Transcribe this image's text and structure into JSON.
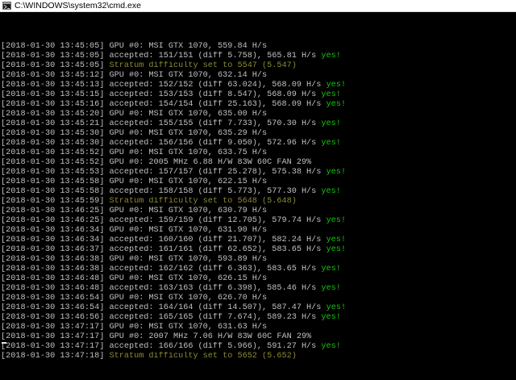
{
  "window": {
    "title": "C:\\WINDOWS\\system32\\cmd.exe",
    "icon": "cmd-console-icon"
  },
  "colors": {
    "background": "#000000",
    "text": "#c0c0c0",
    "accepted_ok": "#16c60c",
    "stratum_notice": "#8b8b33"
  },
  "console": {
    "lines": [
      {
        "ts": "[2018-01-30 13:45:05]",
        "msg": "GPU #0: MSI GTX 1070, 559.84 H/s",
        "type": "gpu",
        "yes": ""
      },
      {
        "ts": "[2018-01-30 13:45:05]",
        "msg": "accepted: 151/151 (diff 5.758), 565.81 H/s",
        "type": "accepted",
        "yes": "yes!"
      },
      {
        "ts": "[2018-01-30 13:45:05]",
        "msg": "Stratum difficulty set to 5547 (5.547)",
        "type": "stratum",
        "yes": ""
      },
      {
        "ts": "[2018-01-30 13:45:12]",
        "msg": "GPU #0: MSI GTX 1070, 632.14 H/s",
        "type": "gpu",
        "yes": ""
      },
      {
        "ts": "[2018-01-30 13:45:13]",
        "msg": "accepted: 152/152 (diff 63.024), 568.09 H/s",
        "type": "accepted",
        "yes": "yes!"
      },
      {
        "ts": "[2018-01-30 13:45:15]",
        "msg": "accepted: 153/153 (diff 8.547), 568.09 H/s",
        "type": "accepted",
        "yes": "yes!"
      },
      {
        "ts": "[2018-01-30 13:45:16]",
        "msg": "accepted: 154/154 (diff 25.163), 568.09 H/s",
        "type": "accepted",
        "yes": "yes!"
      },
      {
        "ts": "[2018-01-30 13:45:20]",
        "msg": "GPU #0: MSI GTX 1070, 635.00 H/s",
        "type": "gpu",
        "yes": ""
      },
      {
        "ts": "[2018-01-30 13:45:21]",
        "msg": "accepted: 155/155 (diff 7.733), 570.30 H/s",
        "type": "accepted",
        "yes": "yes!"
      },
      {
        "ts": "[2018-01-30 13:45:30]",
        "msg": "GPU #0: MSI GTX 1070, 635.29 H/s",
        "type": "gpu",
        "yes": ""
      },
      {
        "ts": "[2018-01-30 13:45:30]",
        "msg": "accepted: 156/156 (diff 9.050), 572.96 H/s",
        "type": "accepted",
        "yes": "yes!"
      },
      {
        "ts": "[2018-01-30 13:45:52]",
        "msg": "GPU #0: MSI GTX 1070, 633.75 H/s",
        "type": "gpu",
        "yes": ""
      },
      {
        "ts": "[2018-01-30 13:45:52]",
        "msg": "GPU #0: 2005 MHz 6.88 H/W 83W 60C FAN 29%",
        "type": "gpu",
        "yes": ""
      },
      {
        "ts": "[2018-01-30 13:45:53]",
        "msg": "accepted: 157/157 (diff 25.278), 575.38 H/s",
        "type": "accepted",
        "yes": "yes!"
      },
      {
        "ts": "[2018-01-30 13:45:58]",
        "msg": "GPU #0: MSI GTX 1070, 622.15 H/s",
        "type": "gpu",
        "yes": ""
      },
      {
        "ts": "[2018-01-30 13:45:58]",
        "msg": "accepted: 158/158 (diff 5.773), 577.30 H/s",
        "type": "accepted",
        "yes": "yes!"
      },
      {
        "ts": "[2018-01-30 13:45:59]",
        "msg": "Stratum difficulty set to 5648 (5.648)",
        "type": "stratum",
        "yes": ""
      },
      {
        "ts": "[2018-01-30 13:46:25]",
        "msg": "GPU #0: MSI GTX 1070, 630.79 H/s",
        "type": "gpu",
        "yes": ""
      },
      {
        "ts": "[2018-01-30 13:46:25]",
        "msg": "accepted: 159/159 (diff 12.705), 579.74 H/s",
        "type": "accepted",
        "yes": "yes!"
      },
      {
        "ts": "[2018-01-30 13:46:34]",
        "msg": "GPU #0: MSI GTX 1070, 631.90 H/s",
        "type": "gpu",
        "yes": ""
      },
      {
        "ts": "[2018-01-30 13:46:34]",
        "msg": "accepted: 160/160 (diff 21.707), 582.24 H/s",
        "type": "accepted",
        "yes": "yes!"
      },
      {
        "ts": "[2018-01-30 13:46:37]",
        "msg": "accepted: 161/161 (diff 62.652), 583.65 H/s",
        "type": "accepted",
        "yes": "yes!"
      },
      {
        "ts": "[2018-01-30 13:46:38]",
        "msg": "GPU #0: MSI GTX 1070, 593.89 H/s",
        "type": "gpu",
        "yes": ""
      },
      {
        "ts": "[2018-01-30 13:46:38]",
        "msg": "accepted: 162/162 (diff 6.363), 583.65 H/s",
        "type": "accepted",
        "yes": "yes!"
      },
      {
        "ts": "[2018-01-30 13:46:48]",
        "msg": "GPU #0: MSI GTX 1070, 626.15 H/s",
        "type": "gpu",
        "yes": ""
      },
      {
        "ts": "[2018-01-30 13:46:48]",
        "msg": "accepted: 163/163 (diff 6.398), 585.46 H/s",
        "type": "accepted",
        "yes": "yes!"
      },
      {
        "ts": "[2018-01-30 13:46:54]",
        "msg": "GPU #0: MSI GTX 1070, 626.70 H/s",
        "type": "gpu",
        "yes": ""
      },
      {
        "ts": "[2018-01-30 13:46:54]",
        "msg": "accepted: 164/164 (diff 14.507), 587.47 H/s",
        "type": "accepted",
        "yes": "yes!"
      },
      {
        "ts": "[2018-01-30 13:46:56]",
        "msg": "accepted: 165/165 (diff 7.674), 589.23 H/s",
        "type": "accepted",
        "yes": "yes!"
      },
      {
        "ts": "[2018-01-30 13:47:17]",
        "msg": "GPU #0: MSI GTX 1070, 631.63 H/s",
        "type": "gpu",
        "yes": ""
      },
      {
        "ts": "[2018-01-30 13:47:17]",
        "msg": "GPU #0: 2007 MHz 7.06 H/W 83W 60C FAN 29%",
        "type": "gpu",
        "yes": ""
      },
      {
        "ts": "[2018-01-30 13:47:17]",
        "msg": "accepted: 166/166 (diff 5.966), 591.27 H/s",
        "type": "accepted",
        "yes": "yes!"
      },
      {
        "ts": "[2018-01-30 13:47:18]",
        "msg": "Stratum difficulty set to 5652 (5.652)",
        "type": "stratum",
        "yes": ""
      }
    ]
  }
}
